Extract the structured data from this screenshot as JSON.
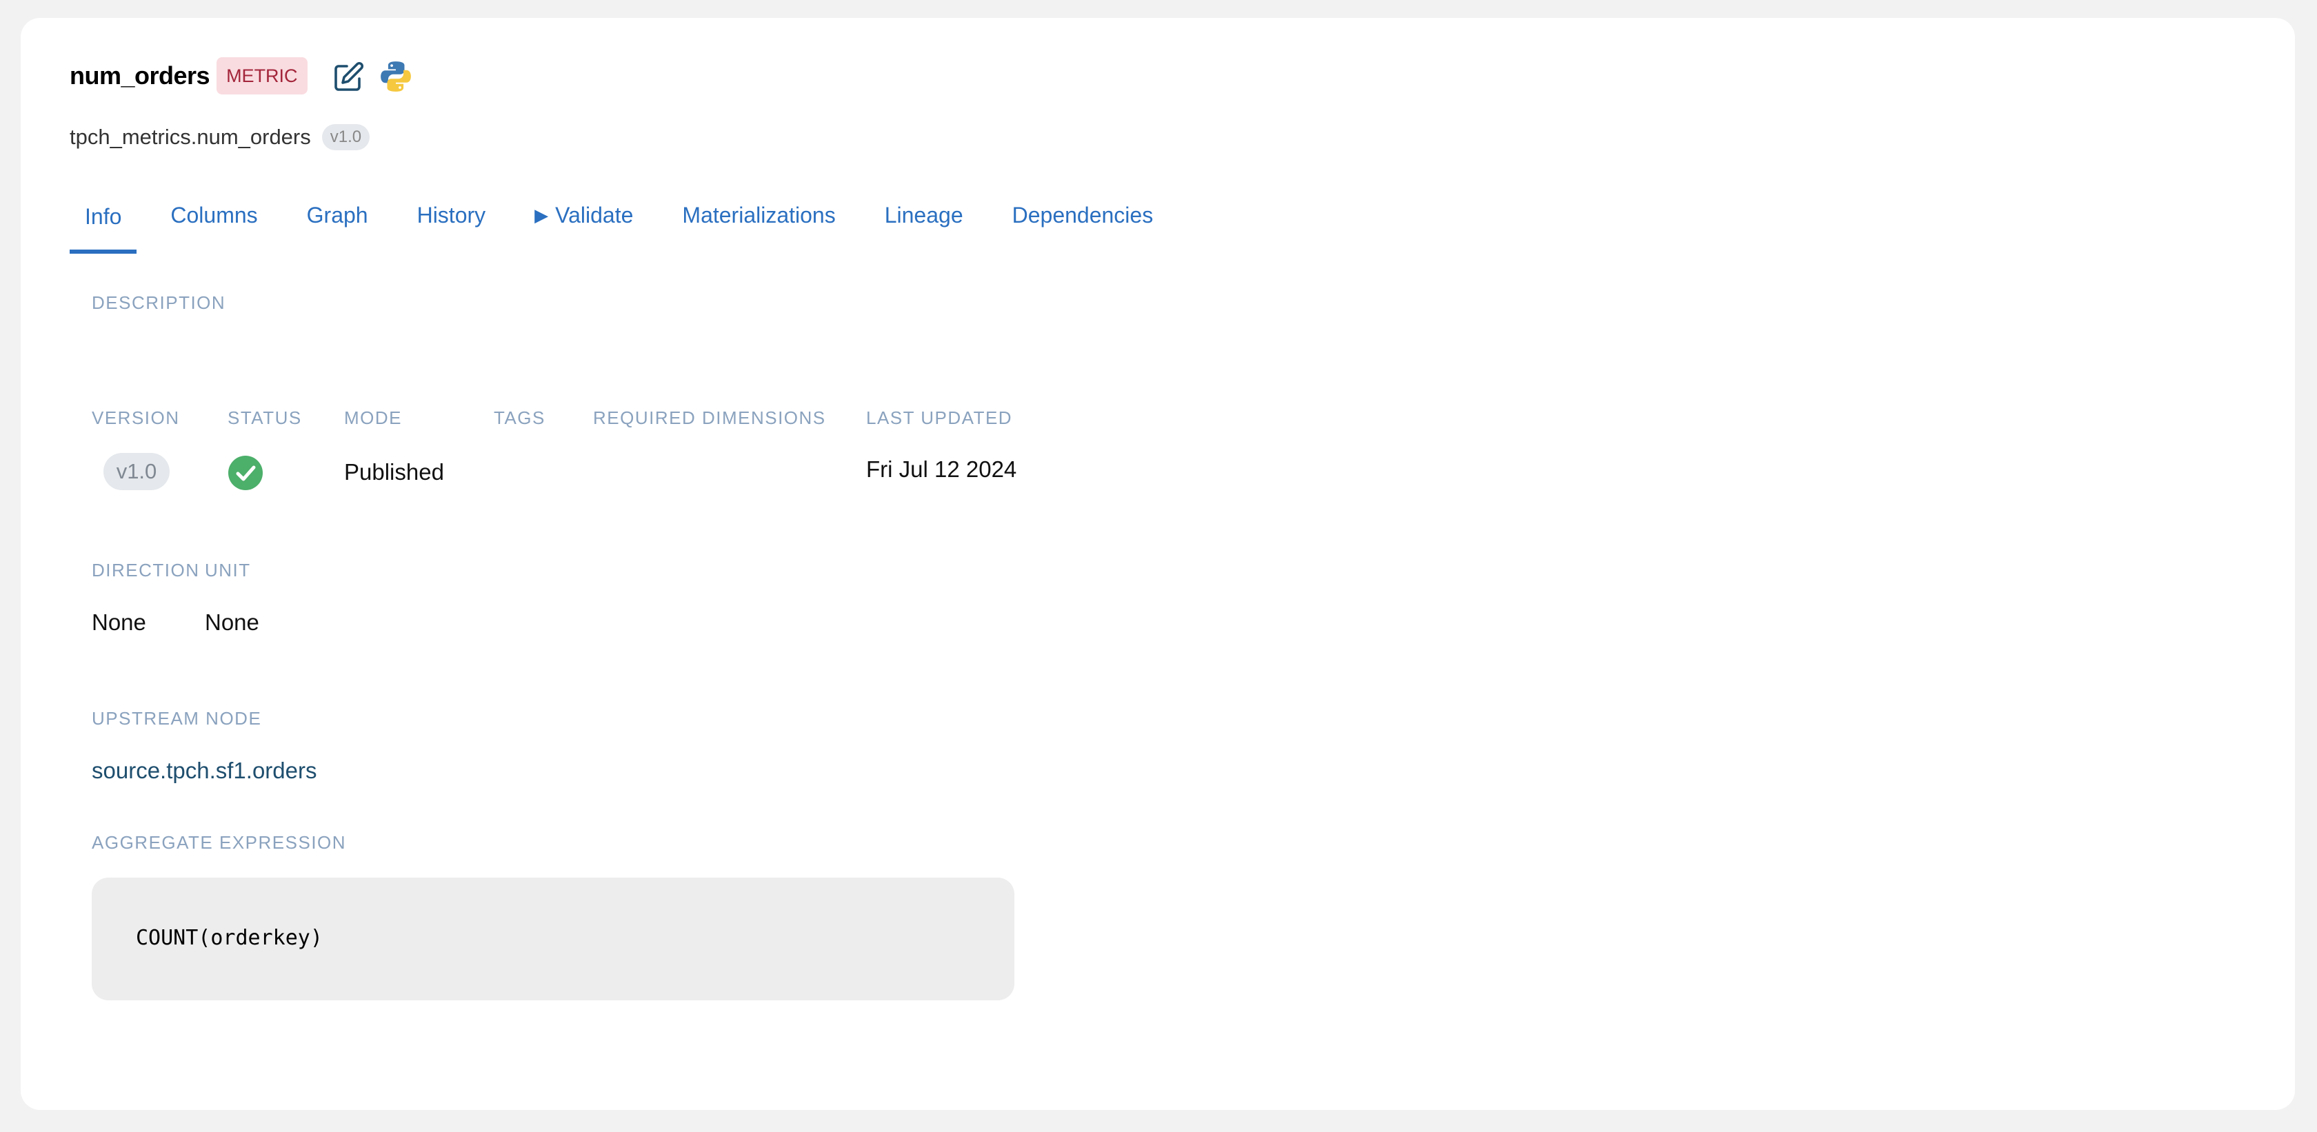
{
  "node": {
    "name": "num_orders",
    "type_badge": "METRIC",
    "full_name": "tpch_metrics.num_orders",
    "version": "v1.0"
  },
  "tabs": [
    {
      "label": "Info",
      "active": true
    },
    {
      "label": "Columns"
    },
    {
      "label": "Graph"
    },
    {
      "label": "History"
    },
    {
      "label": "Validate",
      "icon": "play-icon"
    },
    {
      "label": "Materializations"
    },
    {
      "label": "Lineage"
    },
    {
      "label": "Dependencies"
    }
  ],
  "info": {
    "description_label": "DESCRIPTION",
    "description": "",
    "version_label": "VERSION",
    "version": "v1.0",
    "status_label": "STATUS",
    "status_icon": "check-circle-icon",
    "mode_label": "MODE",
    "mode": "Published",
    "tags_label": "TAGS",
    "required_dimensions_label": "REQUIRED DIMENSIONS",
    "last_updated_label": "LAST UPDATED",
    "last_updated": "Fri Jul 12 2024",
    "direction_label": "DIRECTION",
    "direction": "None",
    "unit_label": "UNIT",
    "unit": "None",
    "upstream_label": "UPSTREAM NODE",
    "upstream_node": "source.tpch.sf1.orders",
    "aggregate_label": "AGGREGATE EXPRESSION",
    "aggregate_expression": "COUNT(orderkey)"
  },
  "colors": {
    "accent": "#2a6fc0",
    "metric_badge_bg": "#f9dce0",
    "metric_badge_fg": "#a3253a",
    "status_ok": "#4caf6a",
    "label": "#8aa2be"
  },
  "icons": {
    "edit": "edit-icon",
    "python": "python-icon"
  }
}
